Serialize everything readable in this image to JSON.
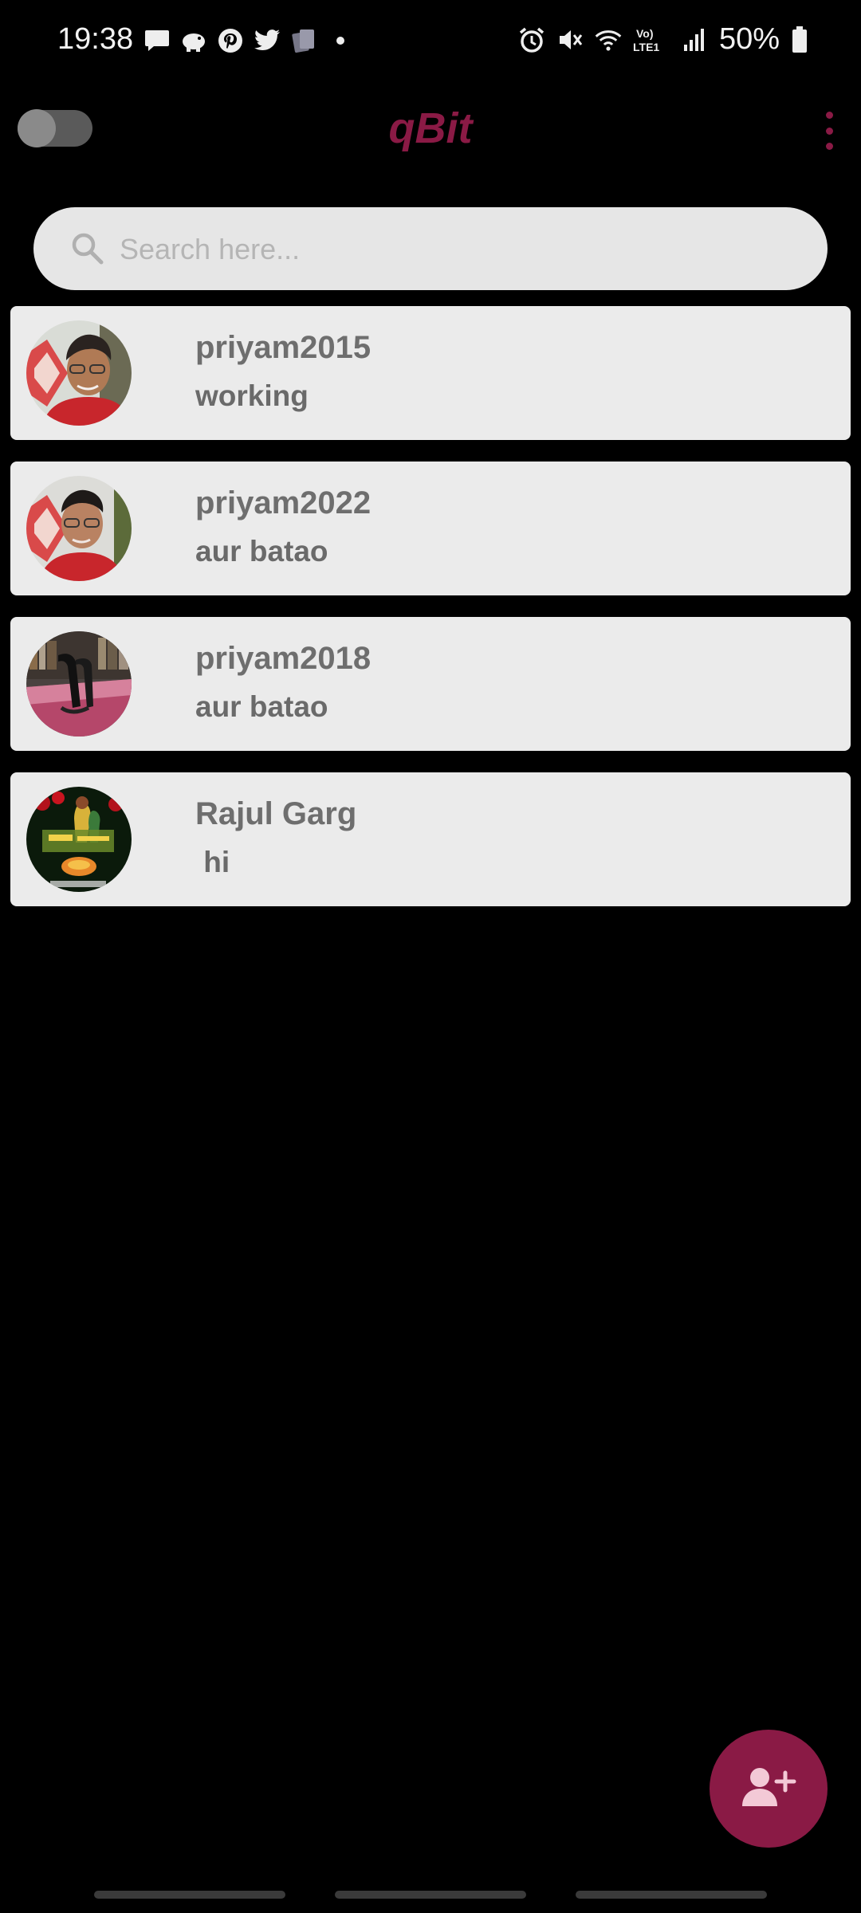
{
  "status_bar": {
    "time": "19:38",
    "battery": "50%",
    "left_icons": [
      "message-icon",
      "piggy-bank-icon",
      "pinterest-icon",
      "twitter-icon",
      "cards-app-icon",
      "dot-icon"
    ],
    "right_icons": [
      "alarm-icon",
      "mute-icon",
      "wifi-icon",
      "volte-icon",
      "signal-icon",
      "battery-icon"
    ],
    "volte_text": "Vo) LTE1"
  },
  "appbar": {
    "title": "qBit",
    "accent_color": "#8a1a45"
  },
  "search": {
    "placeholder": "Search here..."
  },
  "chats": [
    {
      "name": "priyam2015",
      "message": "working",
      "avatar": "avatar-photo-man-glasses-red-shirt"
    },
    {
      "name": "priyam2022",
      "message": "aur batao",
      "avatar": "avatar-photo-man-glasses-red-shirt"
    },
    {
      "name": "priyam2018",
      "message": "aur batao",
      "avatar": "avatar-photo-glasses-on-table"
    },
    {
      "name": "Rajul Garg",
      "message": " hi",
      "avatar": "avatar-devotional-image"
    }
  ],
  "fab": {
    "icon": "add-user-icon"
  }
}
